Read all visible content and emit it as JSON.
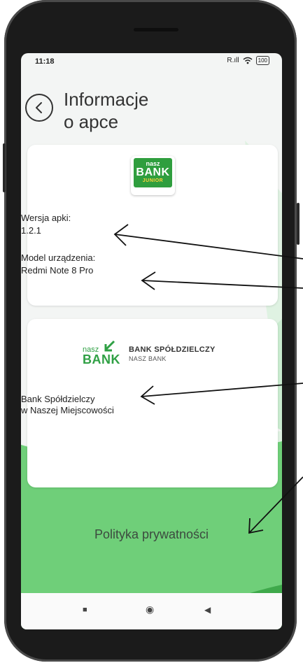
{
  "status_bar": {
    "time": "11:18",
    "signal": "R.ıll",
    "wifi": "wifi-icon",
    "battery": "100"
  },
  "header": {
    "title_line1": "Informacje",
    "title_line2": "o apce"
  },
  "app_info": {
    "logo": {
      "small": "nasz",
      "big": "BANK",
      "junior": "JUNIOR"
    },
    "version_label": "Wersja apki:",
    "version_value": "1.2.1",
    "device_label": "Model urządzenia:",
    "device_value": "Redmi Note 8 Pro"
  },
  "bank_info": {
    "logo": {
      "nasz": "nasz",
      "bank": "BANK",
      "name": "BANK SPÓŁDZIELCZY",
      "sub": "NASZ BANK"
    },
    "name_line1": "Bank Spółdzielczy",
    "name_line2": "w Naszej Miejscowości"
  },
  "privacy_link": "Polityka prywatności",
  "nav": {
    "recents": "■",
    "home": "◉",
    "back": "◀"
  },
  "colors": {
    "accent_green": "#5fc96a",
    "dark_green": "#2f9e3e"
  }
}
